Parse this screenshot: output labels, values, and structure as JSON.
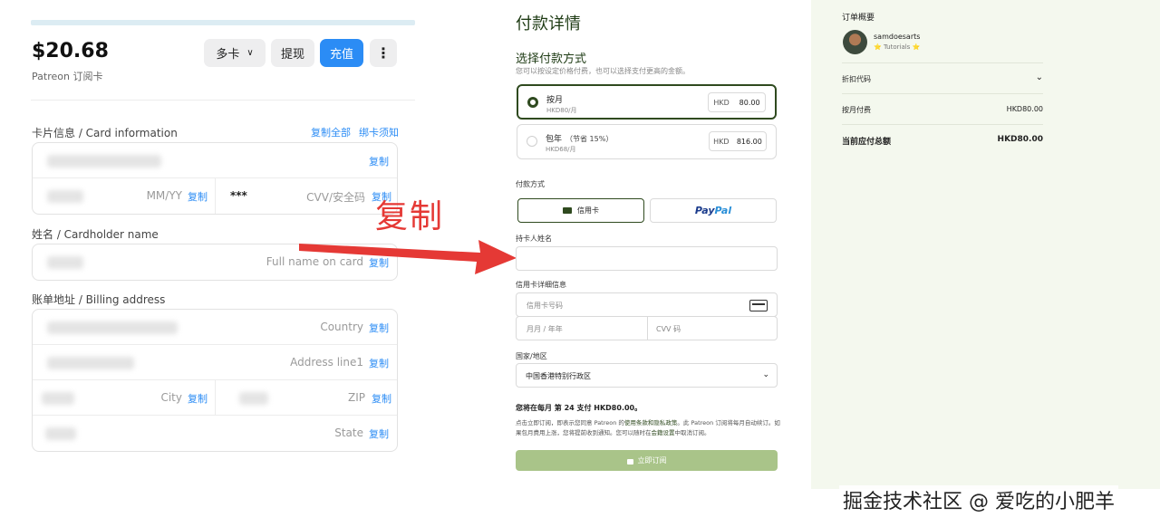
{
  "card": {
    "balance": "$20.68",
    "subtitle": "Patreon 订阅卡",
    "multi_card_label": "多卡",
    "withdraw_label": "提现",
    "topup_label": "充值",
    "more_label": "⋮"
  },
  "card_info": {
    "label": "卡片信息 / Card information",
    "copy_all": "复制全部",
    "binding_notice": "绑卡须知",
    "expiry_placeholder": "MM/YY",
    "cvv_masked": "***",
    "cvv_placeholder": "CVV/安全码"
  },
  "cardholder": {
    "label": "姓名 / Cardholder name",
    "placeholder": "Full name on card"
  },
  "billing": {
    "label": "账单地址 / Billing address",
    "country": "Country",
    "address_line1": "Address line1",
    "city": "City",
    "zip": "ZIP",
    "state": "State"
  },
  "copy_label": "复制",
  "annotation": {
    "text": "复制",
    "color": "#e53935"
  },
  "payment": {
    "title": "付款详情",
    "choose_method": "选择付款方式",
    "hint": "您可以按设定价格付费，也可以选择支付更高的金额。",
    "plans": [
      {
        "name": "按月",
        "note": "",
        "sub": "HKD80/月",
        "currency": "HKD",
        "amount": "80.00",
        "selected": true
      },
      {
        "name": "包年",
        "note": "（节省 15%）",
        "sub": "HKD68/月",
        "currency": "HKD",
        "amount": "816.00",
        "selected": false
      }
    ],
    "method_label": "付款方式",
    "credit_card": "信用卡",
    "paypal_pay": "Pay",
    "paypal_pal": "Pal",
    "cardholder_label": "持卡人姓名",
    "card_details_label": "信用卡详细信息",
    "card_number_placeholder": "信用卡号码",
    "expiry_placeholder": "月月 / 年年",
    "cvv_placeholder": "CVV 码",
    "country_label": "国家/地区",
    "country_value": "中国香港特别行政区",
    "billing_note": "您将在每月 第 24 支付 HKD80.00。",
    "terms_a": "点击立即订阅，即表示您同意 Patreon 的",
    "terms_link": "使用条款和隐私政策",
    "terms_b": "。此 Patreon 订阅将每月自动续订。如果包月费用上涨，您将提前收到通知。您可以随时在",
    "terms_link2": "会籍设置",
    "terms_c": "中取消订阅。",
    "subscribe_label": "立即订阅",
    "accent": "#2f4a1f",
    "button_color": "#a9c489"
  },
  "summary": {
    "title": "订单概要",
    "creator": "samdoesarts",
    "creator_sub": "⭐ Tutorials ⭐",
    "discount_code": "折扣代码",
    "monthly_fee_label": "按月付费",
    "monthly_fee_value": "HKD80.00",
    "total_label": "当前应付总额",
    "total_value": "HKD80.00"
  },
  "watermark": "掘金技术社区 @ 爱吃的小肥羊"
}
